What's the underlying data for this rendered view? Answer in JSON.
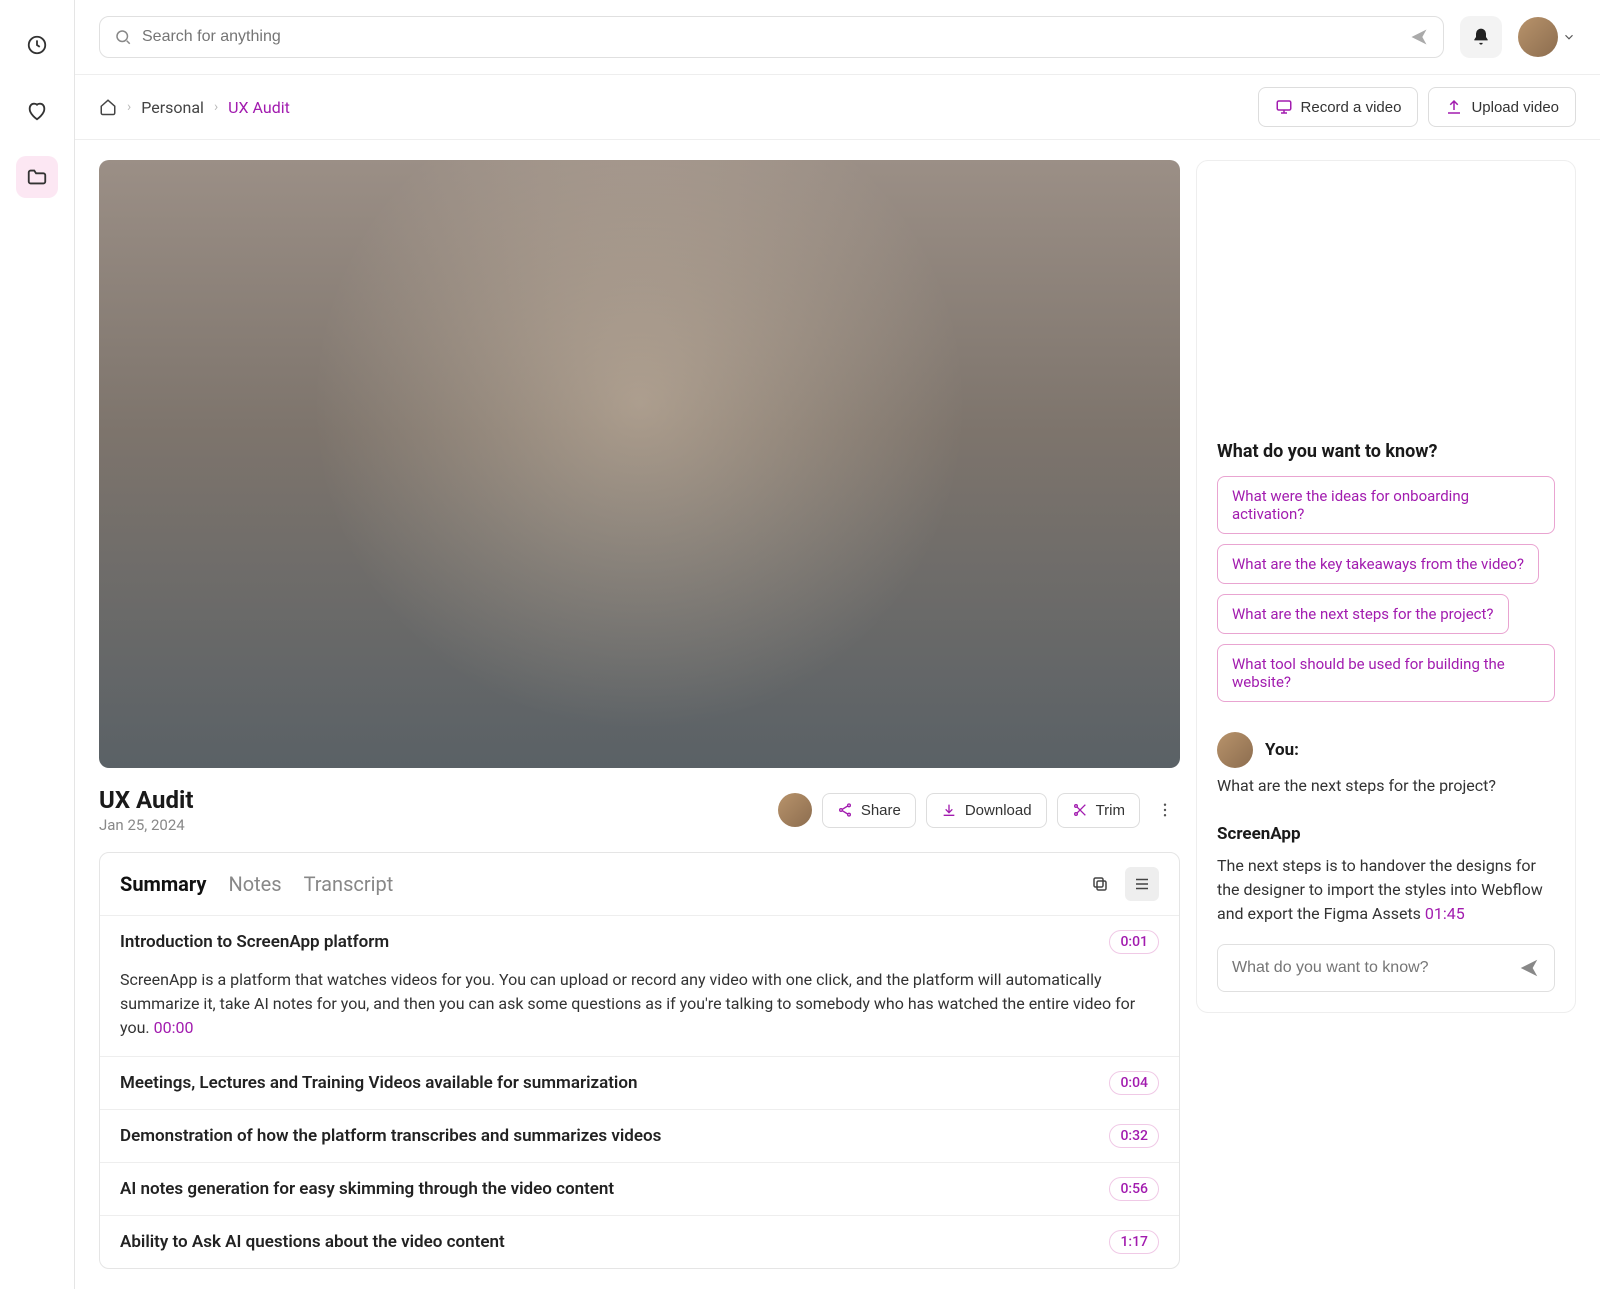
{
  "search": {
    "placeholder": "Search for anything"
  },
  "breadcrumb": {
    "home": "Home",
    "personal": "Personal",
    "current": "UX Audit"
  },
  "header_actions": {
    "record": "Record a video",
    "upload": "Upload video"
  },
  "video": {
    "title": "UX Audit",
    "date": "Jan 25, 2024"
  },
  "video_actions": {
    "share": "Share",
    "download": "Download",
    "trim": "Trim"
  },
  "tabs": {
    "summary": "Summary",
    "notes": "Notes",
    "transcript": "Transcript"
  },
  "summary": {
    "sections": [
      {
        "title": "Introduction to ScreenApp platform",
        "ts": "0:01",
        "body": "ScreenApp is a platform that watches videos for you. You can upload or record any video with one click, and the platform will automatically summarize it, take AI notes for you, and then you can ask some questions as if you're talking to somebody who has watched the entire video for you.",
        "body_ts": "00:00"
      },
      {
        "title": "Meetings, Lectures and Training Videos available for summarization",
        "ts": "0:04"
      },
      {
        "title": "Demonstration of how the platform transcribes and summarizes videos",
        "ts": "0:32"
      },
      {
        "title": "AI notes generation for easy skimming through the video content",
        "ts": "0:56"
      },
      {
        "title": "Ability to Ask AI questions about the video content",
        "ts": "1:17"
      }
    ]
  },
  "chat": {
    "heading": "What do you want to know?",
    "suggestions": [
      "What were the ideas for onboarding activation?",
      "What are the key takeaways from the video?",
      "What are the next steps for the project?",
      "What tool should be used for building the website?"
    ],
    "you_label": "You:",
    "user_msg": "What are the next steps for the project?",
    "bot_name": "ScreenApp",
    "bot_msg": "The next steps is to handover the designs for the designer to import the styles into Webflow and export the Figma Assets",
    "bot_ts": "01:45",
    "input_placeholder": "What do you want to know?"
  }
}
